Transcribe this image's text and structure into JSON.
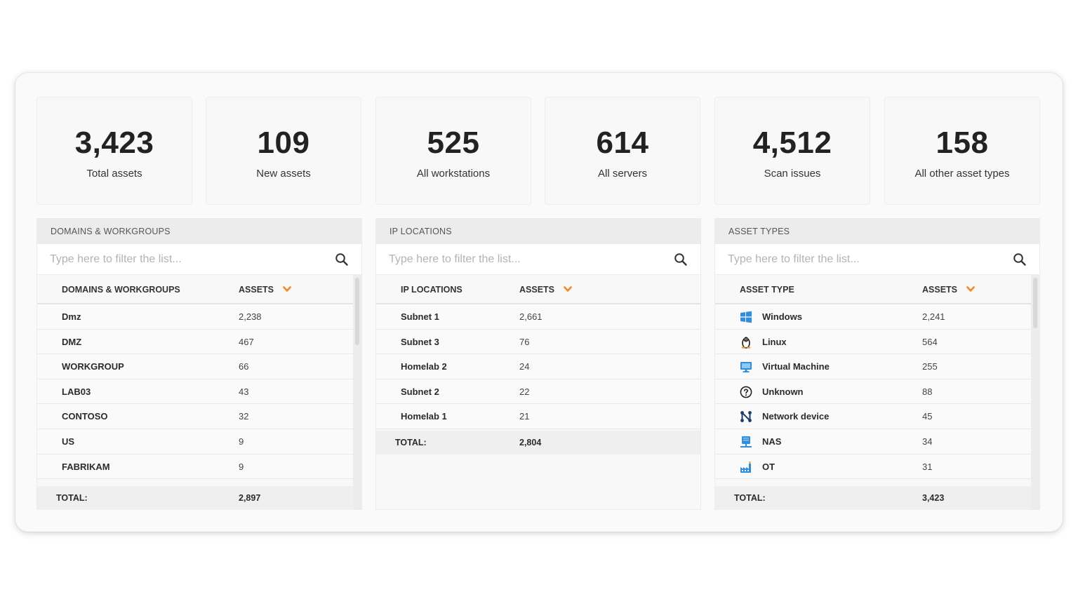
{
  "stats": [
    {
      "value": "3,423",
      "label": "Total assets"
    },
    {
      "value": "109",
      "label": "New assets"
    },
    {
      "value": "525",
      "label": "All workstations"
    },
    {
      "value": "614",
      "label": "All servers"
    },
    {
      "value": "4,512",
      "label": "Scan issues"
    },
    {
      "value": "158",
      "label": "All other asset types"
    }
  ],
  "filter_placeholder": "Type here to filter the list...",
  "domains": {
    "title": "DOMAINS & WORKGROUPS",
    "col_name": "DOMAINS & WORKGROUPS",
    "col_assets": "ASSETS",
    "rows": [
      {
        "name": "Dmz",
        "assets": "2,238"
      },
      {
        "name": "DMZ",
        "assets": "467"
      },
      {
        "name": "WORKGROUP",
        "assets": "66"
      },
      {
        "name": "LAB03",
        "assets": "43"
      },
      {
        "name": "CONTOSO",
        "assets": "32"
      },
      {
        "name": "US",
        "assets": "9"
      },
      {
        "name": "FABRIKAM",
        "assets": "9"
      }
    ],
    "total_label": "TOTAL:",
    "total_value": "2,897"
  },
  "ip": {
    "title": "IP LOCATIONS",
    "col_name": "IP LOCATIONS",
    "col_assets": "ASSETS",
    "rows": [
      {
        "name": "Subnet 1",
        "assets": "2,661"
      },
      {
        "name": "Subnet 3",
        "assets": "76"
      },
      {
        "name": "Homelab 2",
        "assets": "24"
      },
      {
        "name": "Subnet 2",
        "assets": "22"
      },
      {
        "name": "Homelab 1",
        "assets": "21"
      }
    ],
    "total_label": "TOTAL:",
    "total_value": "2,804"
  },
  "types": {
    "title": "ASSET TYPES",
    "col_name": "ASSET TYPE",
    "col_assets": "ASSETS",
    "rows": [
      {
        "name": "Windows",
        "assets": "2,241",
        "icon": "windows-icon"
      },
      {
        "name": "Linux",
        "assets": "564",
        "icon": "linux-icon"
      },
      {
        "name": "Virtual Machine",
        "assets": "255",
        "icon": "virtual-machine-icon"
      },
      {
        "name": "Unknown",
        "assets": "88",
        "icon": "unknown-icon"
      },
      {
        "name": "Network device",
        "assets": "45",
        "icon": "network-device-icon"
      },
      {
        "name": "NAS",
        "assets": "34",
        "icon": "nas-icon"
      },
      {
        "name": "OT",
        "assets": "31",
        "icon": "ot-icon"
      }
    ],
    "total_label": "TOTAL:",
    "total_value": "3,423"
  },
  "colors": {
    "accent_orange": "#f08a24",
    "icon_blue": "#2f8fdd"
  }
}
